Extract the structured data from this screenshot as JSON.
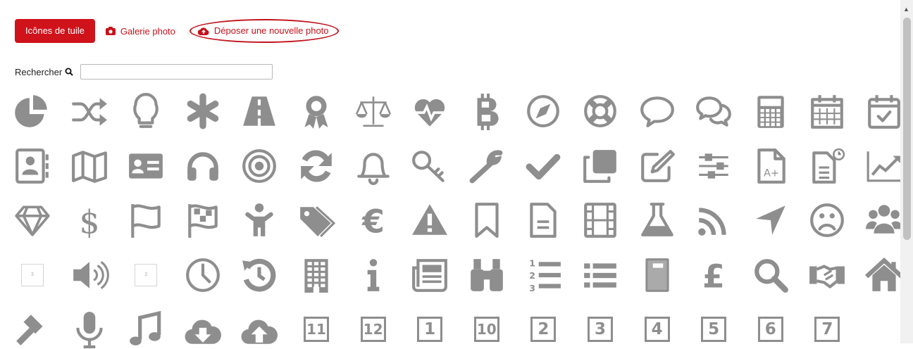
{
  "tabs": {
    "tiles_label": "Icônes de tuile",
    "gallery_label": "Galerie photo",
    "upload_label": "Déposer une nouvelle photo"
  },
  "search": {
    "label": "Rechercher",
    "value": ""
  },
  "colors": {
    "accent": "#d0121b",
    "icon": "#8e8e8e"
  },
  "icons": [
    "pie-chart",
    "shuffle",
    "lightbulb",
    "asterisk",
    "road",
    "award",
    "balance-scale",
    "heartbeat",
    "bitcoin",
    "compass",
    "life-ring",
    "comment",
    "comments",
    "calculator",
    "calendar",
    "calendar-check",
    "address-book",
    "map",
    "id-card",
    "headphones",
    "bullseye",
    "refresh",
    "bell",
    "key",
    "wrench",
    "check",
    "clone",
    "edit",
    "sliders",
    "grade-file",
    "file-clock",
    "line-chart",
    "diamond",
    "dollar",
    "flag",
    "flag-checkered",
    "child",
    "tags",
    "euro",
    "warning",
    "bookmark",
    "file-text",
    "film",
    "flask",
    "rss",
    "location-arrow",
    "frown",
    "users",
    "small-tile-3",
    "volume-up",
    "small-tile-2",
    "clock",
    "history",
    "building",
    "info",
    "newspaper",
    "binoculars",
    "ordered-list",
    "list",
    "notebook",
    "pound",
    "search",
    "handshake",
    "home",
    "gavel",
    "microphone",
    "music",
    "cloud-download",
    "cloud-upload",
    "number-11",
    "number-12",
    "number-1",
    "number-10",
    "number-2",
    "number-3",
    "number-4",
    "number-5",
    "number-6",
    "number-7"
  ],
  "number_tiles": [
    "11",
    "12",
    "1",
    "10",
    "2",
    "3",
    "4",
    "5",
    "6",
    "7"
  ],
  "small_tiles": [
    "3",
    "2"
  ]
}
